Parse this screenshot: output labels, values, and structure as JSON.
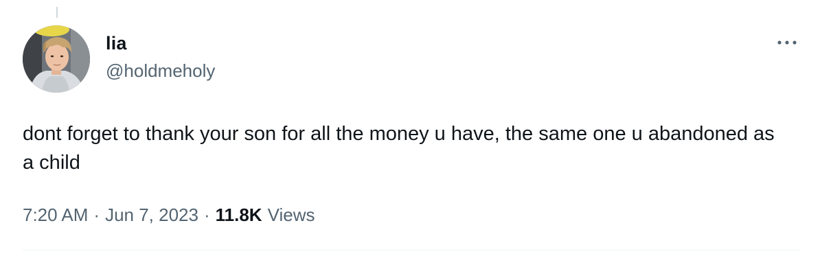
{
  "tweet": {
    "author": {
      "display_name": "lia",
      "handle": "@holdmeholy"
    },
    "text": "dont forget to thank your son for all the money u have, the same one u abandoned as a child",
    "meta": {
      "time": "7:20 AM",
      "separator": "·",
      "date": "Jun 7, 2023",
      "views_count": "11.8K",
      "views_label": "Views"
    },
    "icons": {
      "more": "more-horizontal-icon"
    }
  }
}
